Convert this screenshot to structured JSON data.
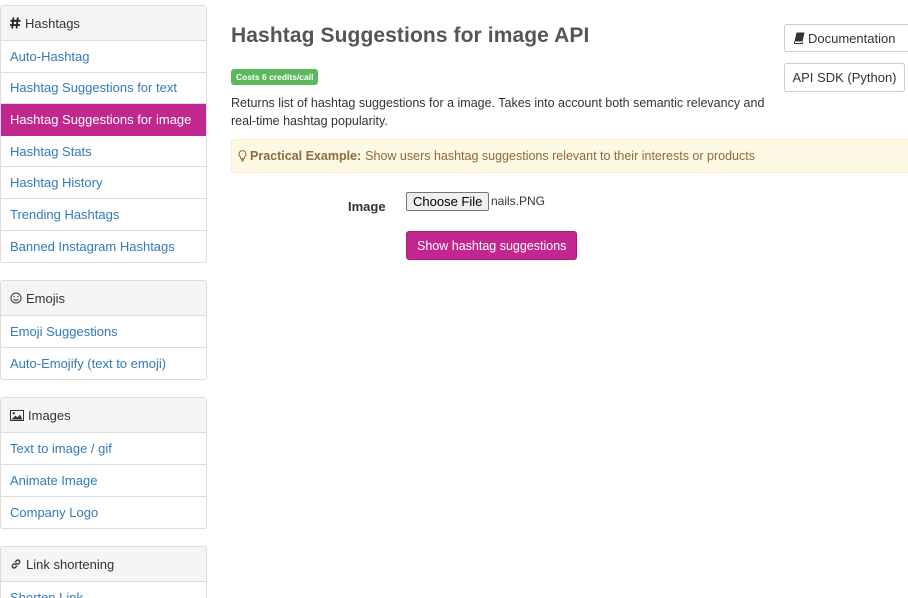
{
  "sidebar": {
    "sections": [
      {
        "title": "Hashtags",
        "icon": "hash-icon",
        "items": [
          {
            "label": "Auto-Hashtag"
          },
          {
            "label": "Hashtag Suggestions for text"
          },
          {
            "label": "Hashtag Suggestions for image",
            "active": true
          },
          {
            "label": "Hashtag Stats"
          },
          {
            "label": "Hashtag History"
          },
          {
            "label": "Trending Hashtags"
          },
          {
            "label": "Banned Instagram Hashtags"
          }
        ]
      },
      {
        "title": "Emojis",
        "icon": "smiley-icon",
        "items": [
          {
            "label": "Emoji Suggestions"
          },
          {
            "label": "Auto-Emojify (text to emoji)"
          }
        ]
      },
      {
        "title": "Images",
        "icon": "image-icon",
        "items": [
          {
            "label": "Text to image / gif"
          },
          {
            "label": "Animate Image"
          },
          {
            "label": "Company Logo"
          }
        ]
      },
      {
        "title": "Link shortening",
        "icon": "link-icon",
        "items": [
          {
            "label": "Shorten Link"
          }
        ]
      }
    ]
  },
  "main": {
    "title": "Hashtag Suggestions for image API",
    "badge": "Costs 6 credits/call",
    "description": "Returns list of hashtag suggestions for a image. Takes into account both semantic relevancy and real-time hashtag popularity.",
    "example": {
      "label": "Practical Example:",
      "text": "Show users hashtag suggestions relevant to their interests or products"
    },
    "buttons": {
      "documentation": "Documentation",
      "sdk": "API SDK (Python)"
    },
    "form": {
      "image_label": "Image",
      "choose_file": "Choose File",
      "file_name": "nails.PNG",
      "submit": "Show hashtag suggestions"
    }
  },
  "colors": {
    "accent": "#c2278f",
    "link": "#337ab7",
    "badge": "#5cb85c",
    "example_bg": "#fcf8e3"
  }
}
